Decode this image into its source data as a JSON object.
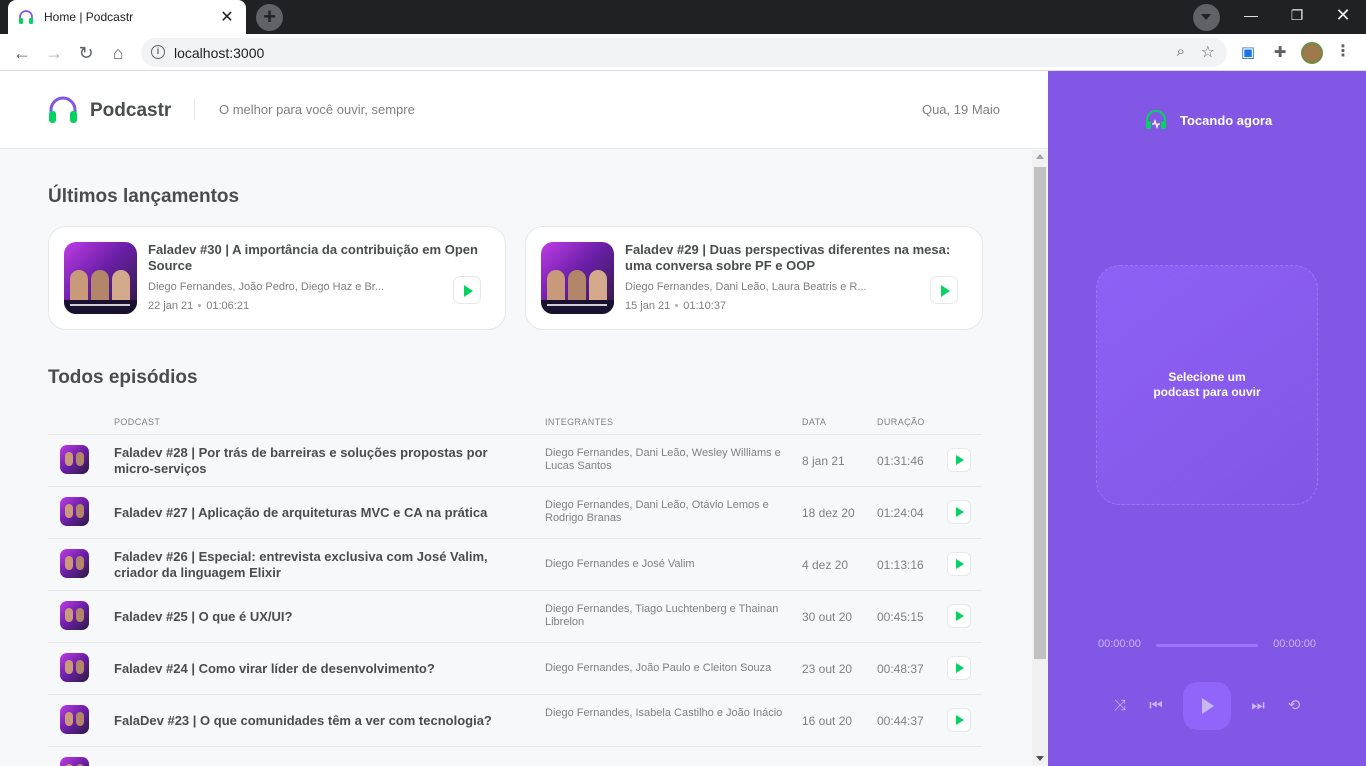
{
  "browser": {
    "tab_title": "Home | Podcastr",
    "tab_close": "✕",
    "new_tab": "+",
    "url": "localhost:3000",
    "info_icon": "i",
    "window_controls": {
      "minimize": "—",
      "restore": "❐",
      "close": "✕"
    }
  },
  "header": {
    "logo_text": "Podcastr",
    "tagline": "O melhor para você ouvir, sempre",
    "date": "Qua, 19 Maio"
  },
  "latest": {
    "title": "Últimos lançamentos",
    "episodes": [
      {
        "title": "Faladev #30 | A importância da contribuição em Open Source",
        "members": "Diego Fernandes, João Pedro, Diego Haz e Br...",
        "date": "22 jan 21",
        "duration": "01:06:21"
      },
      {
        "title": "Faladev #29 | Duas perspectivas diferentes na mesa: uma conversa sobre PF e OOP",
        "members": "Diego Fernandes, Dani Leão, Laura Beatris e R...",
        "date": "15 jan 21",
        "duration": "01:10:37"
      }
    ]
  },
  "all": {
    "title": "Todos episódios",
    "columns": {
      "podcast": "PODCAST",
      "members": "INTEGRANTES",
      "date": "DATA",
      "duration": "DURAÇÃO"
    },
    "rows": [
      {
        "title": "Faladev #28 | Por trás de barreiras e soluções propostas por micro-serviços",
        "members": "Diego Fernandes, Dani Leão, Wesley Williams e Lucas Santos",
        "date": "8 jan 21",
        "duration": "01:31:46"
      },
      {
        "title": "Faladev #27 | Aplicação de arquiteturas MVC e CA na prática",
        "members": "Diego Fernandes, Dani Leão, Otávio Lemos e Rodrigo Branas",
        "date": "18 dez 20",
        "duration": "01:24:04"
      },
      {
        "title": "Faladev #26 | Especial: entrevista exclusiva com José Valim, criador da linguagem Elixir",
        "members": "Diego Fernandes e José Valim",
        "date": "4 dez 20",
        "duration": "01:13:16"
      },
      {
        "title": "Faladev #25 | O que é UX/UI?",
        "members": "Diego Fernandes, Tiago Luchtenberg e Thainan Librelon",
        "date": "30 out 20",
        "duration": "00:45:15"
      },
      {
        "title": "Faladev #24 | Como virar líder de desenvolvimento?",
        "members": "Diego Fernandes, João Paulo e Cleiton Souza",
        "date": "23 out 20",
        "duration": "00:48:37"
      },
      {
        "title": "FalaDev #23 | O que comunidades têm a ver com tecnologia?",
        "members": "Diego Fernandes, Isabela Castilho e João Inácio",
        "date": "16 out 20",
        "duration": "00:44:37"
      }
    ]
  },
  "player": {
    "now_playing": "Tocando agora",
    "empty_line1": "Selecione um",
    "empty_line2": "podcast para ouvir",
    "current_time": "00:00:00",
    "total_time": "00:00:00",
    "progress": 0
  },
  "colors": {
    "accent": "#8257e5",
    "play_green": "#04d361",
    "text": "#494d4b",
    "muted": "#808080"
  }
}
